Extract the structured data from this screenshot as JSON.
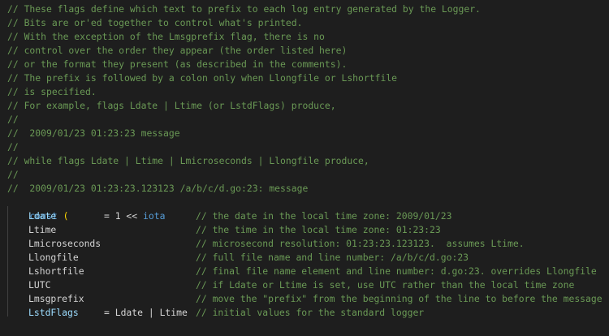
{
  "editor": {
    "language": "go",
    "colors": {
      "background": "#1e1e1e",
      "comment": "#6a9955",
      "keyword": "#569cd6",
      "identifier": "#9cdcfe",
      "text": "#d4d4d4",
      "bracket": "#ffd700"
    },
    "comment_lines": [
      "// These flags define which text to prefix to each log entry generated by the Logger.",
      "// Bits are or'ed together to control what's printed.",
      "// With the exception of the Lmsgprefix flag, there is no",
      "// control over the order they appear (the order listed here)",
      "// or the format they present (as described in the comments).",
      "// The prefix is followed by a colon only when Llongfile or Lshortfile",
      "// is specified.",
      "// For example, flags Ldate | Ltime (or LstdFlags) produce,",
      "//",
      "//  2009/01/23 01:23:23 message",
      "//",
      "// while flags Ldate | Ltime | Lmicroseconds | Llongfile produce,",
      "//",
      "//  2009/01/23 01:23:23.123123 /a/b/c/d.go:23: message"
    ],
    "const_keyword": "const",
    "open_paren": "(",
    "close_paren": ")",
    "constants": [
      {
        "name": "Ldate",
        "value": "= 1 << ",
        "iota": "iota",
        "comment": "// the date in the local time zone: 2009/01/23"
      },
      {
        "name": "Ltime",
        "comment": "// the time in the local time zone: 01:23:23"
      },
      {
        "name": "Lmicroseconds",
        "comment": "// microsecond resolution: 01:23:23.123123.  assumes Ltime."
      },
      {
        "name": "Llongfile",
        "comment": "// full file name and line number: /a/b/c/d.go:23"
      },
      {
        "name": "Lshortfile",
        "comment": "// final file name element and line number: d.go:23. overrides Llongfile"
      },
      {
        "name": "LUTC",
        "comment": "// if Ldate or Ltime is set, use UTC rather than the local time zone"
      },
      {
        "name": "Lmsgprefix",
        "comment": "// move the \"prefix\" from the beginning of the line to before the message"
      },
      {
        "name": "LstdFlags",
        "value": "= Ldate | Ltime",
        "comment": "// initial values for the standard logger"
      }
    ]
  }
}
